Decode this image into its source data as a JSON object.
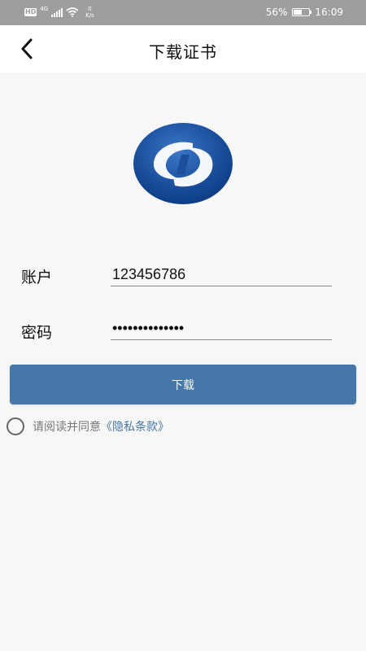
{
  "status_bar": {
    "hd": "HD",
    "network": "4G",
    "speed_value": "0",
    "speed_unit": "K/s",
    "battery_percent": "56%",
    "battery_level": 0.56,
    "time": "16:09"
  },
  "nav": {
    "title": "下载证书",
    "back_icon": "chevron-left-icon"
  },
  "logo": {
    "colors": [
      "#1b4f9c",
      "#0a3a82",
      "#ffffff"
    ]
  },
  "form": {
    "account_label": "账户",
    "account_value": "123456786",
    "password_label": "密码",
    "password_value": "••••••••••••••"
  },
  "actions": {
    "download_label": "下载"
  },
  "agreement": {
    "checked": false,
    "prefix": "请阅读并同意",
    "link": "《隐私条款》"
  },
  "colors": {
    "accent": "#4677a8",
    "status_bar": "#9e9e9e",
    "background": "#f7f7f7"
  }
}
